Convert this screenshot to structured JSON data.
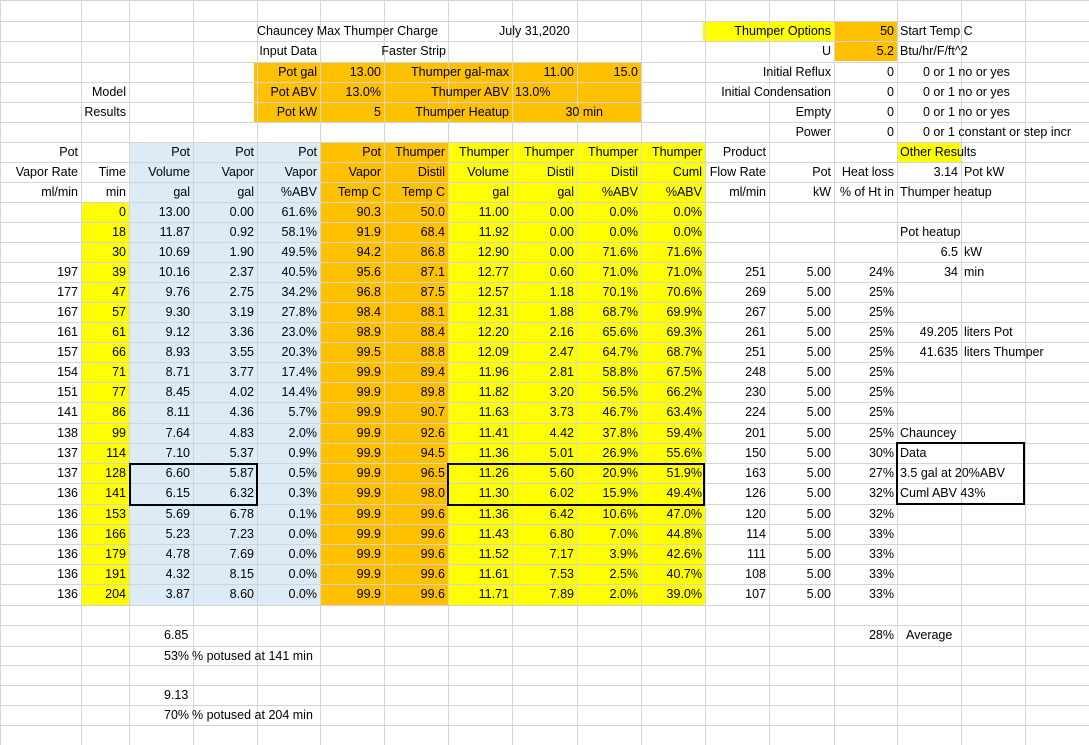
{
  "colors": {
    "yellow": "#ffff00",
    "orange": "#ffc000",
    "light_blue": "#ddebf7",
    "grid": "#d4d4d4"
  },
  "title": {
    "sheet_name": "Chauncey Max Thumper Charge",
    "date": "July 31,2020",
    "input_data": "Input Data",
    "faster_strip": "Faster Strip",
    "model": "Model",
    "results": "Results"
  },
  "inputs": {
    "pot_gal_label": "Pot gal",
    "pot_gal": "13.00",
    "pot_abv_label": "Pot ABV",
    "pot_abv": "13.0%",
    "pot_kw_label": "Pot  kW",
    "pot_kw": "5",
    "thumper_gal_max_label": "Thumper gal-max",
    "thumper_gal_max": "11.00",
    "thumper_gal_max2": "15.0",
    "thumper_abv_label": "Thumper ABV",
    "thumper_abv": "13.0%",
    "thumper_heatup_label": "Thumper Heatup",
    "thumper_heatup": "30 min"
  },
  "options": {
    "title": "Thumper Options",
    "title_value": "50",
    "title_note": "Start Temp C",
    "u_label": "U",
    "u_value": "5.2",
    "u_note": "Btu/hr/F/ft^2",
    "reflux_label": "Initial Reflux",
    "reflux_value": "0",
    "reflux_note": "0 or 1  no or yes",
    "cond_label": "Initial Condensation",
    "cond_value": "0",
    "cond_note": "0 or 1  no or yes",
    "empty_label": "Empty",
    "empty_value": "0",
    "empty_note": "0 or 1  no or yes",
    "power_label": "Power",
    "power_value": "0",
    "power_note": "0 or 1 constant or step incr"
  },
  "headers": {
    "row1": [
      "Pot",
      "",
      "Pot",
      "Pot",
      "Pot",
      "Pot",
      "Thumper",
      "Thumper",
      "Thumper",
      "Thumper",
      "Thumper",
      "Product",
      "",
      ""
    ],
    "row2": [
      "Vapor Rate",
      "Time",
      "Volume",
      "Vapor",
      "Vapor",
      "Vapor",
      "Distil",
      "Volume",
      "Distil",
      "Distil",
      "Cuml",
      "Flow Rate",
      "Pot",
      "Heat loss"
    ],
    "row3": [
      "ml/min",
      "min",
      "gal",
      "gal",
      "%ABV",
      "Temp  C",
      "Temp  C",
      "gal",
      "gal",
      "%ABV",
      "%ABV",
      "ml/min",
      "kW",
      "% of Ht in"
    ]
  },
  "other_results": {
    "title": "Other Results",
    "pot_kw_value": "3.14",
    "pot_kw_label": "Pot kW",
    "thumper_heatup": "Thumper heatup",
    "pot_heatup": "Pot heatup",
    "pot_heatup_kw": "6.5",
    "pot_heatup_kw_unit": "kW",
    "pot_heatup_min": "34",
    "pot_heatup_min_unit": "min",
    "pot_liters": "49.205",
    "pot_liters_label": "liters  Pot",
    "thumper_liters": "41.635",
    "thumper_liters_label": "liters  Thumper",
    "note1": "Chauncey",
    "note2": "Data",
    "note3": "3.5 gal at 20%ABV",
    "note4": "Cuml ABV 43%"
  },
  "rows": [
    [
      "",
      "0",
      "13.00",
      "0.00",
      "61.6%",
      "90.3",
      "50.0",
      "11.00",
      "0.00",
      "0.0%",
      "0.0%",
      "",
      "",
      ""
    ],
    [
      "",
      "18",
      "11.87",
      "0.92",
      "58.1%",
      "91.9",
      "68.4",
      "11.92",
      "0.00",
      "0.0%",
      "0.0%",
      "",
      "",
      ""
    ],
    [
      "",
      "30",
      "10.69",
      "1.90",
      "49.5%",
      "94.2",
      "86.8",
      "12.90",
      "0.00",
      "71.6%",
      "71.6%",
      "",
      "",
      ""
    ],
    [
      "197",
      "39",
      "10.16",
      "2.37",
      "40.5%",
      "95.6",
      "87.1",
      "12.77",
      "0.60",
      "71.0%",
      "71.0%",
      "251",
      "5.00",
      "24%"
    ],
    [
      "177",
      "47",
      "9.76",
      "2.75",
      "34.2%",
      "96.8",
      "87.5",
      "12.57",
      "1.18",
      "70.1%",
      "70.6%",
      "269",
      "5.00",
      "25%"
    ],
    [
      "167",
      "57",
      "9.30",
      "3.19",
      "27.8%",
      "98.4",
      "88.1",
      "12.31",
      "1.88",
      "68.7%",
      "69.9%",
      "267",
      "5.00",
      "25%"
    ],
    [
      "161",
      "61",
      "9.12",
      "3.36",
      "23.0%",
      "98.9",
      "88.4",
      "12.20",
      "2.16",
      "65.6%",
      "69.3%",
      "261",
      "5.00",
      "25%"
    ],
    [
      "157",
      "66",
      "8.93",
      "3.55",
      "20.3%",
      "99.5",
      "88.8",
      "12.09",
      "2.47",
      "64.7%",
      "68.7%",
      "251",
      "5.00",
      "25%"
    ],
    [
      "154",
      "71",
      "8.71",
      "3.77",
      "17.4%",
      "99.9",
      "89.4",
      "11.96",
      "2.81",
      "58.8%",
      "67.5%",
      "248",
      "5.00",
      "25%"
    ],
    [
      "151",
      "77",
      "8.45",
      "4.02",
      "14.4%",
      "99.9",
      "89.8",
      "11.82",
      "3.20",
      "56.5%",
      "66.2%",
      "230",
      "5.00",
      "25%"
    ],
    [
      "141",
      "86",
      "8.11",
      "4.36",
      "5.7%",
      "99.9",
      "90.7",
      "11.63",
      "3.73",
      "46.7%",
      "63.4%",
      "224",
      "5.00",
      "25%"
    ],
    [
      "138",
      "99",
      "7.64",
      "4.83",
      "2.0%",
      "99.9",
      "92.6",
      "11.41",
      "4.42",
      "37.8%",
      "59.4%",
      "201",
      "5.00",
      "25%"
    ],
    [
      "137",
      "114",
      "7.10",
      "5.37",
      "0.9%",
      "99.9",
      "94.5",
      "11.36",
      "5.01",
      "26.9%",
      "55.6%",
      "150",
      "5.00",
      "30%"
    ],
    [
      "137",
      "128",
      "6.60",
      "5.87",
      "0.5%",
      "99.9",
      "96.5",
      "11.26",
      "5.60",
      "20.9%",
      "51.9%",
      "163",
      "5.00",
      "27%"
    ],
    [
      "136",
      "141",
      "6.15",
      "6.32",
      "0.3%",
      "99.9",
      "98.0",
      "11.30",
      "6.02",
      "15.9%",
      "49.4%",
      "126",
      "5.00",
      "32%"
    ],
    [
      "136",
      "153",
      "5.69",
      "6.78",
      "0.1%",
      "99.9",
      "99.6",
      "11.36",
      "6.42",
      "10.6%",
      "47.0%",
      "120",
      "5.00",
      "32%"
    ],
    [
      "136",
      "166",
      "5.23",
      "7.23",
      "0.0%",
      "99.9",
      "99.6",
      "11.43",
      "6.80",
      "7.0%",
      "44.8%",
      "114",
      "5.00",
      "33%"
    ],
    [
      "136",
      "179",
      "4.78",
      "7.69",
      "0.0%",
      "99.9",
      "99.6",
      "11.52",
      "7.17",
      "3.9%",
      "42.6%",
      "111",
      "5.00",
      "33%"
    ],
    [
      "136",
      "191",
      "4.32",
      "8.15",
      "0.0%",
      "99.9",
      "99.6",
      "11.61",
      "7.53",
      "2.5%",
      "40.7%",
      "108",
      "5.00",
      "33%"
    ],
    [
      "136",
      "204",
      "3.87",
      "8.60",
      "0.0%",
      "99.9",
      "99.6",
      "11.71",
      "7.89",
      "2.0%",
      "39.0%",
      "107",
      "5.00",
      "33%"
    ]
  ],
  "footer": {
    "avg_value": "28%",
    "avg_label": "Average",
    "val1": "6.85",
    "pct1": "53%",
    "pct1_text": "% potused at 141 min",
    "val2": "9.13",
    "pct2": "70%",
    "pct2_text": "% potused at 204 min"
  }
}
